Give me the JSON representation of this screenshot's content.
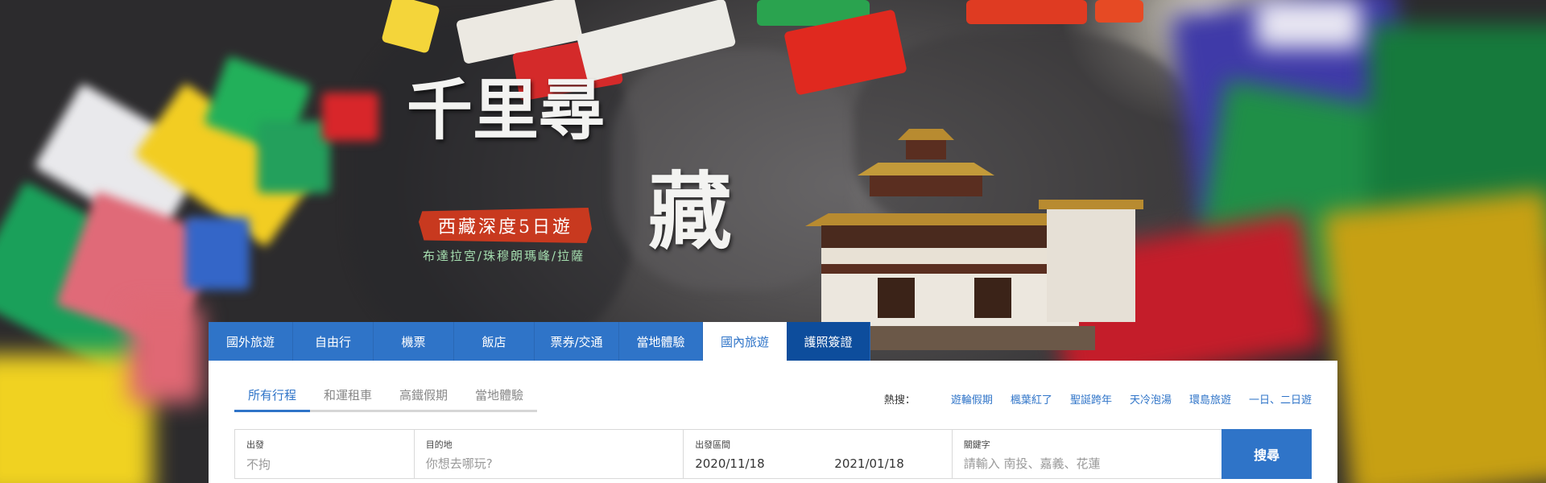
{
  "hero": {
    "title_line1": "千里尋",
    "title_line2": "藏",
    "subtitle": "西藏深度5日遊",
    "route": "布達拉宮/珠穆朗瑪峰/拉薩"
  },
  "nav": {
    "tabs": [
      {
        "label": "國外旅遊"
      },
      {
        "label": "自由行"
      },
      {
        "label": "機票"
      },
      {
        "label": "飯店"
      },
      {
        "label": "票券/交通"
      },
      {
        "label": "當地體驗"
      },
      {
        "label": "國內旅遊",
        "active": true
      },
      {
        "label": "護照簽證"
      }
    ]
  },
  "search": {
    "subtabs": [
      {
        "label": "所有行程",
        "active": true
      },
      {
        "label": "和運租車"
      },
      {
        "label": "高鐵假期"
      },
      {
        "label": "當地體驗"
      }
    ],
    "hot": {
      "label": "熱搜：",
      "links": [
        "遊輪假期",
        "楓葉紅了",
        "聖誕跨年",
        "天冷泡湯",
        "環島旅遊",
        "一日、二日遊"
      ]
    },
    "departure": {
      "label": "出發",
      "value": "不拘"
    },
    "destination": {
      "label": "目的地",
      "placeholder": "你想去哪玩?"
    },
    "date_range": {
      "label": "出發區間",
      "start": "2020/11/18",
      "end": "2021/01/18"
    },
    "keyword": {
      "label": "關鍵字",
      "placeholder": "請輸入 南投、嘉義、花蓮"
    },
    "button": "搜尋"
  },
  "colors": {
    "primary": "#2f74c8",
    "nav_dark": "#0d4d9c",
    "badge_red": "#c8391f",
    "route_green": "#a6dfb0"
  }
}
